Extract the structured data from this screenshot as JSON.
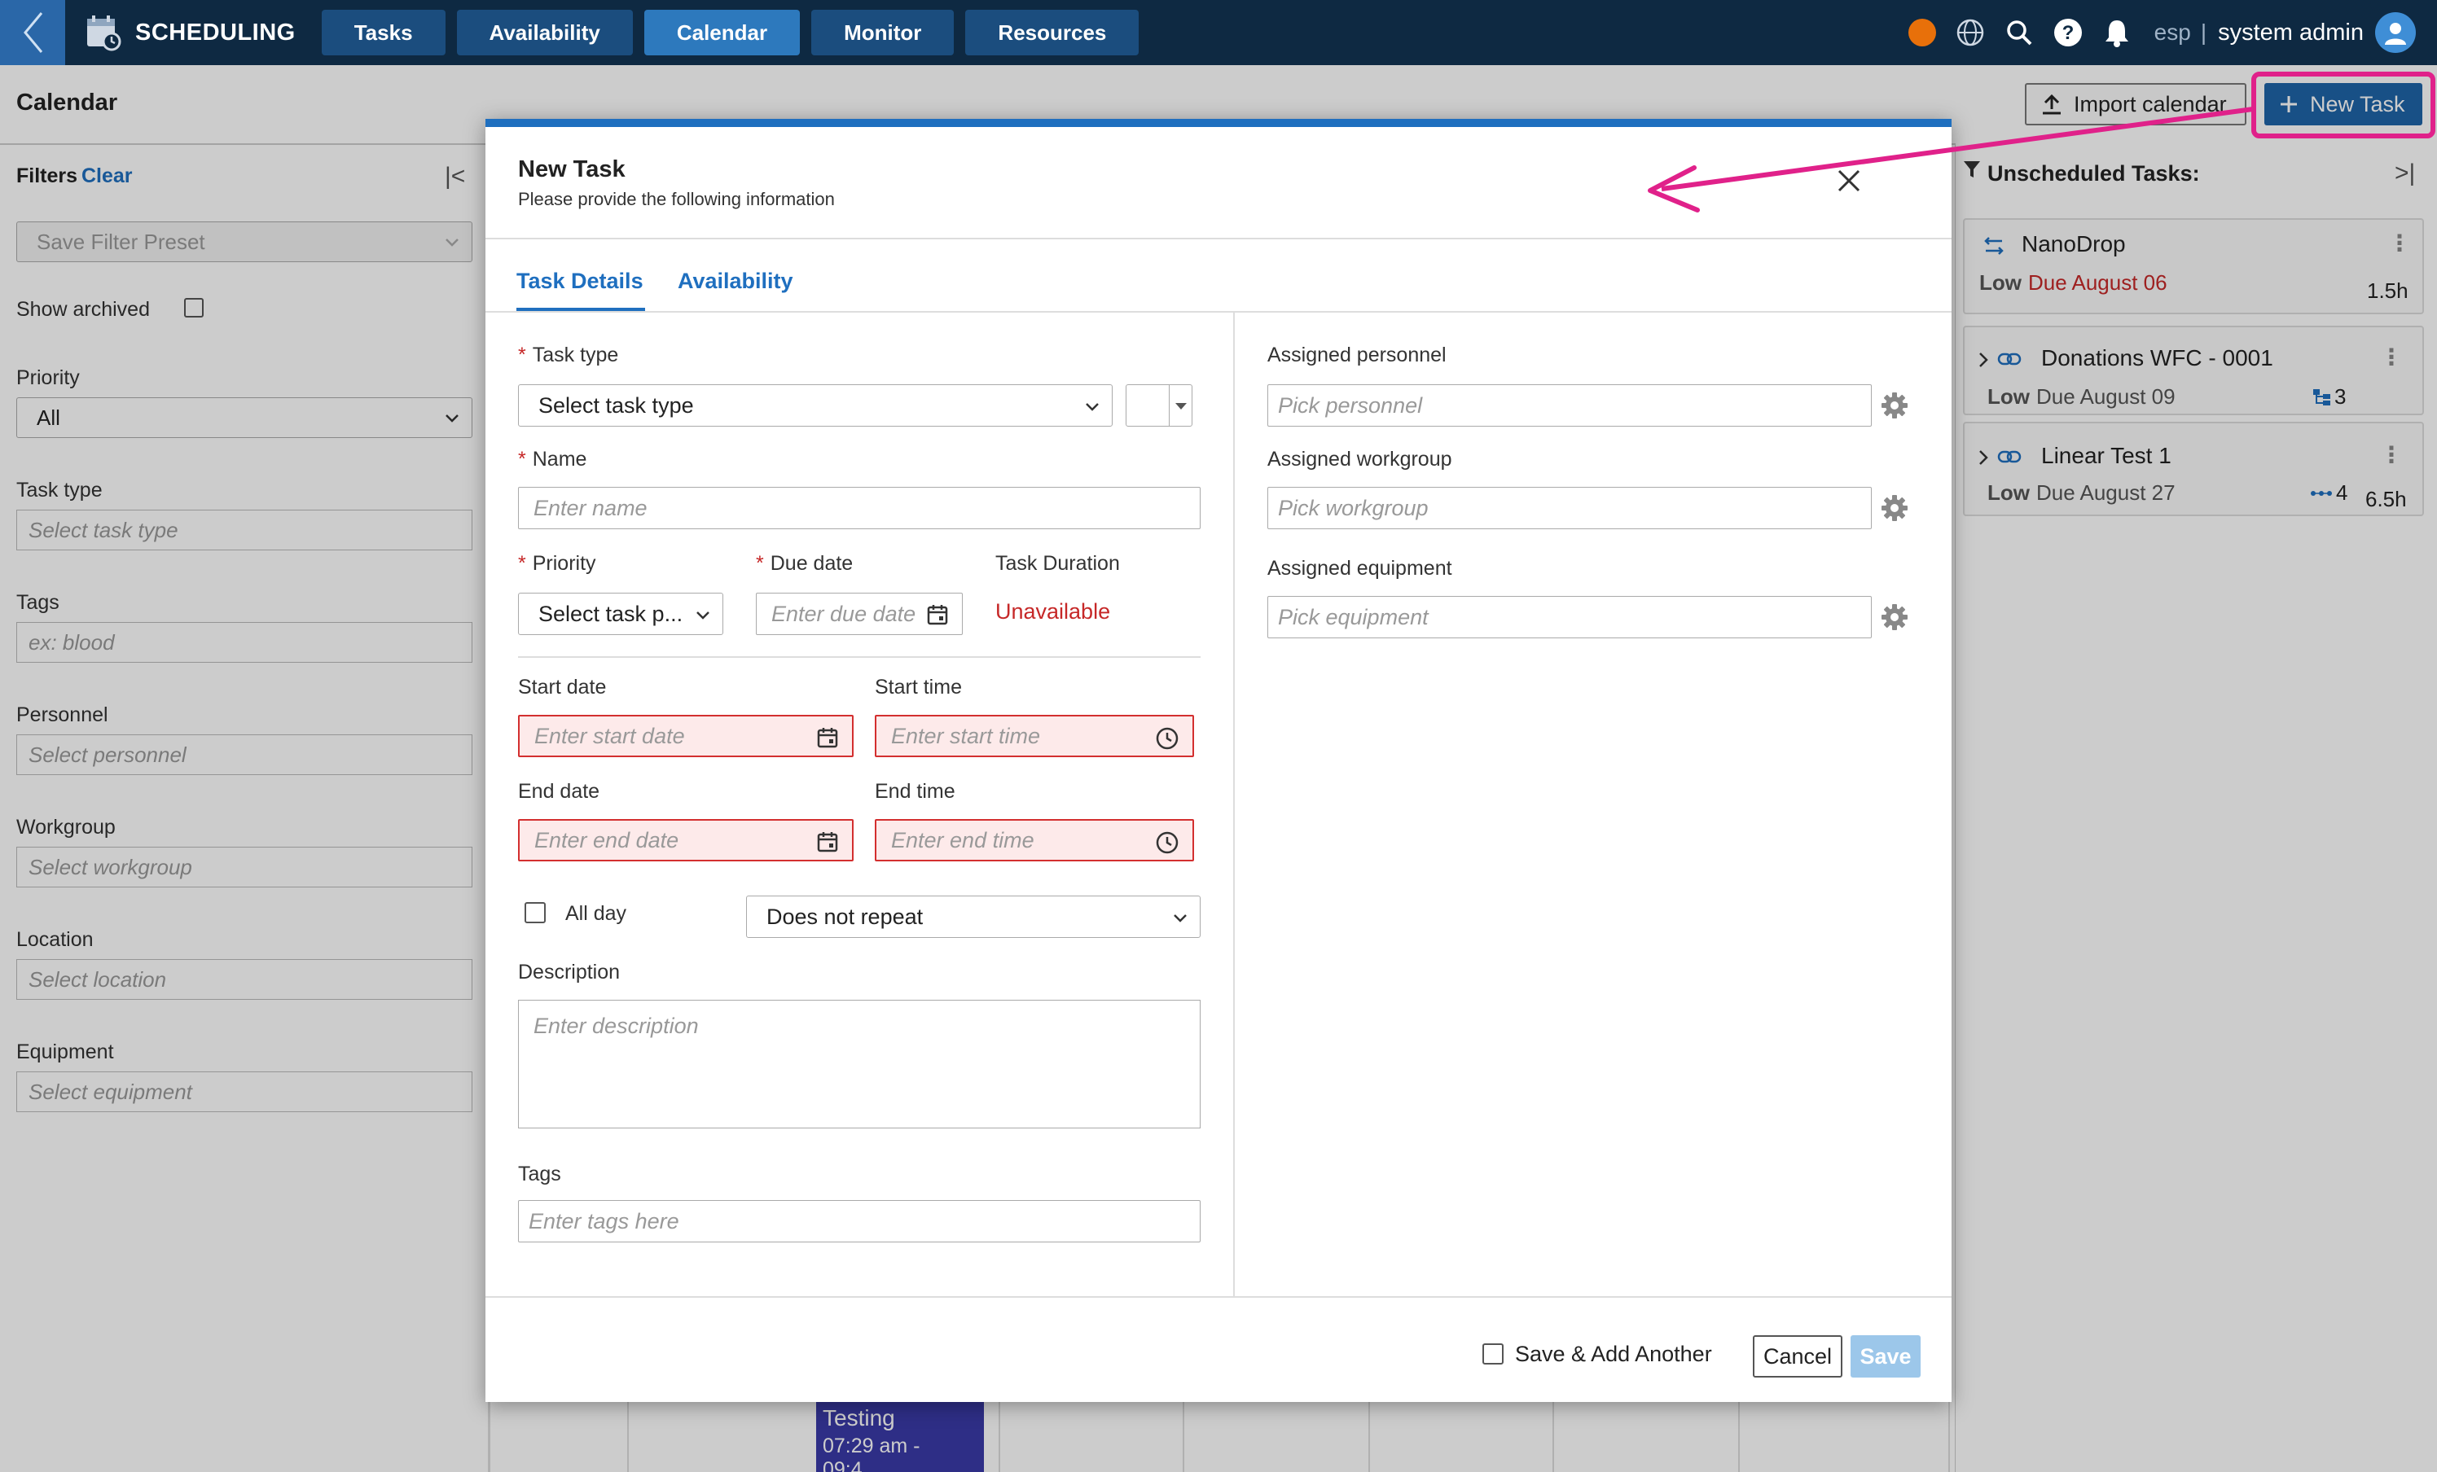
{
  "topnav": {
    "app_name": "SCHEDULING",
    "tabs": [
      {
        "label": "Tasks"
      },
      {
        "label": "Availability"
      },
      {
        "label": "Calendar"
      },
      {
        "label": "Monitor"
      },
      {
        "label": "Resources"
      }
    ],
    "active_tab": "Calendar",
    "language": "esp",
    "separator": "|",
    "username": "system admin"
  },
  "page": {
    "title": "Calendar",
    "import_button": "Import calendar",
    "new_task_button": "New Task"
  },
  "filters": {
    "heading": "Filters",
    "clear": "Clear",
    "preset_placeholder": "Save Filter Preset",
    "show_archived": "Show archived",
    "priority_label": "Priority",
    "priority_value": "All",
    "task_type_label": "Task type",
    "task_type_placeholder": "Select task type",
    "tags_label": "Tags",
    "tags_placeholder": "ex: blood",
    "personnel_label": "Personnel",
    "personnel_placeholder": "Select personnel",
    "workgroup_label": "Workgroup",
    "workgroup_placeholder": "Select workgroup",
    "location_label": "Location",
    "location_placeholder": "Select location",
    "equipment_label": "Equipment",
    "equipment_placeholder": "Select equipment"
  },
  "unscheduled": {
    "title": "Unscheduled Tasks:",
    "tasks": [
      {
        "name": "NanoDrop",
        "priority": "Low",
        "due": "Due August 06",
        "duration": "1.5h",
        "count": ""
      },
      {
        "name": "Donations WFC - 0001",
        "priority": "Low",
        "due": "Due August 09",
        "duration": "",
        "count": "3"
      },
      {
        "name": "Linear Test 1",
        "priority": "Low",
        "due": "Due August 27",
        "duration": "6.5h",
        "count": "4"
      }
    ]
  },
  "calendar_event": {
    "title": "Testing",
    "time": "07:29 am - 09:4..."
  },
  "modal": {
    "title": "New Task",
    "subtitle": "Please provide the following information",
    "tabs": [
      "Task Details",
      "Availability"
    ],
    "task_type_label": "Task type",
    "task_type_value": "Select task type",
    "name_label": "Name",
    "name_placeholder": "Enter name",
    "priority_label": "Priority",
    "priority_value": "Select task p...",
    "due_date_label": "Due date",
    "due_date_placeholder": "Enter due date",
    "duration_label": "Task Duration",
    "duration_value": "Unavailable",
    "start_date_label": "Start date",
    "start_date_placeholder": "Enter start date",
    "start_time_label": "Start time",
    "start_time_placeholder": "Enter start time",
    "end_date_label": "End date",
    "end_date_placeholder": "Enter end date",
    "end_time_label": "End time",
    "end_time_placeholder": "Enter end time",
    "all_day_label": "All day",
    "repeat_value": "Does not repeat",
    "description_label": "Description",
    "description_placeholder": "Enter description",
    "tags_label": "Tags",
    "tags_placeholder": "Enter tags here",
    "personnel_label": "Assigned personnel",
    "personnel_placeholder": "Pick personnel",
    "workgroup_label": "Assigned workgroup",
    "workgroup_placeholder": "Pick workgroup",
    "equipment_label": "Assigned equipment",
    "equipment_placeholder": "Pick equipment",
    "save_add_another": "Save & Add Another",
    "cancel": "Cancel",
    "save": "Save"
  },
  "colors": {
    "nav_bg": "#0e2942",
    "nav_button": "#1b4d7e",
    "nav_active": "#2d79bd",
    "accent": "#1f6fbf",
    "error": "#c62828",
    "annotation": "#e0218a"
  }
}
